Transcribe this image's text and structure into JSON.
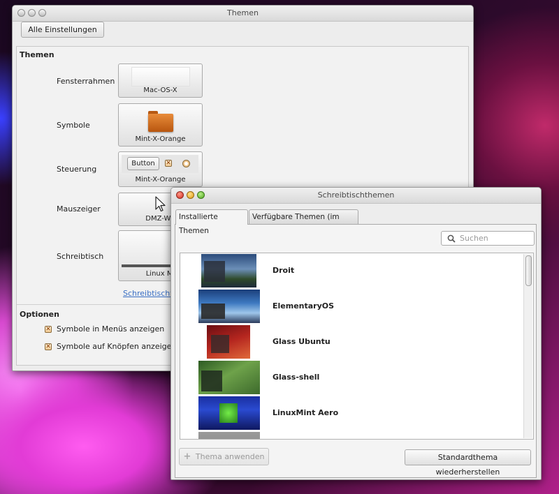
{
  "main_window": {
    "title": "Themen",
    "all_settings_button": "Alle Einstellungen",
    "themes_section": "Themen",
    "rows": [
      {
        "label": "Fensterrahmen",
        "value": "Mac-OS-X"
      },
      {
        "label": "Symbole",
        "value": "Mint-X-Orange"
      },
      {
        "label": "Steuerung",
        "value": "Mint-X-Orange",
        "preview_button": "Button"
      },
      {
        "label": "Mauszeiger",
        "value": "DMZ-Wh"
      },
      {
        "label": "Schreibtisch",
        "value": "Linux Mi"
      }
    ],
    "desktop_link": "Schreibtischth",
    "options_section": "Optionen",
    "options": [
      {
        "label": "Symbole in Menüs anzeigen",
        "checked": true
      },
      {
        "label": "Symbole auf Knöpfen anzeigen",
        "checked": true
      }
    ]
  },
  "dialog": {
    "title": "Schreibtischthemen",
    "tabs": [
      "Installierte Themen",
      "Verfügbare Themen (im Netz)"
    ],
    "active_tab": 0,
    "search_placeholder": "Suchen",
    "themes": [
      {
        "name": "Droit"
      },
      {
        "name": "ElementaryOS"
      },
      {
        "name": "Glass Ubuntu"
      },
      {
        "name": "Glass-shell"
      },
      {
        "name": "LinuxMint Aero"
      }
    ],
    "apply_button": "Thema anwenden",
    "restore_button": "Standardthema wiederherstellen"
  },
  "colors": {
    "link": "#3a6fc4",
    "accent_orange": "#d2731e"
  },
  "icons": {
    "cursor": "arrow-cursor-icon",
    "folder": "folder-icon",
    "add": "plus-icon",
    "search": "search-icon"
  }
}
